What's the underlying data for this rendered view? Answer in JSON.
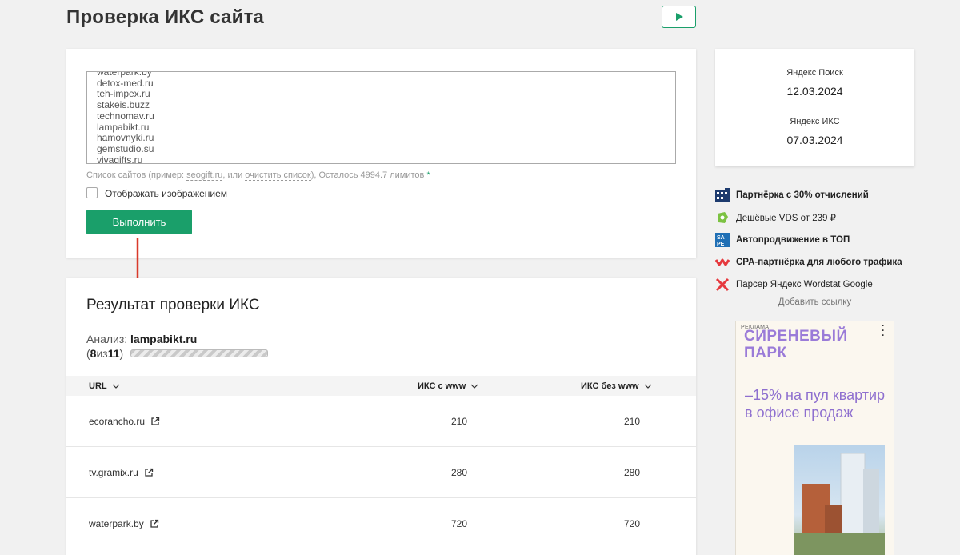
{
  "header": {
    "title": "Проверка ИКС сайта"
  },
  "form": {
    "textarea_lines": [
      "waterpark.by",
      "detox-med.ru",
      "teh-impex.ru",
      "stakeis.buzz",
      "technomav.ru",
      "lampabikt.ru",
      "hamovnyki.ru",
      "gemstudio.su",
      "vivagifts.ru"
    ],
    "hint_prefix": "Список сайтов (пример: ",
    "hint_example": "seogift.ru",
    "hint_mid": ", или ",
    "hint_clear": "очистить список",
    "hint_suffix": "),  Осталось 4994.7 лимитов",
    "hint_star": "*",
    "checkbox_label": "Отображать изображением",
    "run_label": "Выполнить"
  },
  "results": {
    "title": "Результат проверки ИКС",
    "analysis_label": "Анализ:",
    "analysis_site": "lampabikt.ru",
    "counter_open": "(",
    "counter_done": "8",
    "counter_of": " из ",
    "counter_total": "11",
    "counter_close": ")",
    "progress_fraction": 0.73,
    "columns": {
      "url": "URL",
      "iks_www": "ИКС с www",
      "iks_no_www": "ИКС без www"
    },
    "rows": [
      {
        "url": "ecorancho.ru",
        "iks_www": "210",
        "iks_no_www": "210"
      },
      {
        "url": "tv.gramix.ru",
        "iks_www": "280",
        "iks_no_www": "280"
      },
      {
        "url": "waterpark.by",
        "iks_www": "720",
        "iks_no_www": "720"
      }
    ]
  },
  "dates": {
    "search_label": "Яндекс Поиск",
    "search_date": "12.03.2024",
    "iks_label": "Яндекс ИКС",
    "iks_date": "07.03.2024"
  },
  "links": [
    {
      "label": "Партнёрка с 30% отчислений",
      "bold": true,
      "icon": "partner-icon"
    },
    {
      "label": "Дешёвые VDS от 239 ₽",
      "bold": false,
      "icon": "vds-icon"
    },
    {
      "label": "Автопродвижение в ТОП",
      "bold": true,
      "icon": "sape-icon"
    },
    {
      "label": "CPA-партнёрка для любого трафика",
      "bold": true,
      "icon": "cpa-icon"
    },
    {
      "label": "Парсер Яндекс Wordstat Google",
      "bold": false,
      "icon": "parser-icon"
    }
  ],
  "add_link": "Добавить ссылку",
  "ad": {
    "tag": "РЕКЛАМА",
    "brand_line1": "СИРЕНЕВЫЙ",
    "brand_line2": "ПАРК",
    "text": "–15% на пул квартир в офисе продаж"
  },
  "colors": {
    "accent": "#1a9f6a",
    "ad_purple": "#8e6fcf",
    "arrow_red": "#d93a2b"
  }
}
